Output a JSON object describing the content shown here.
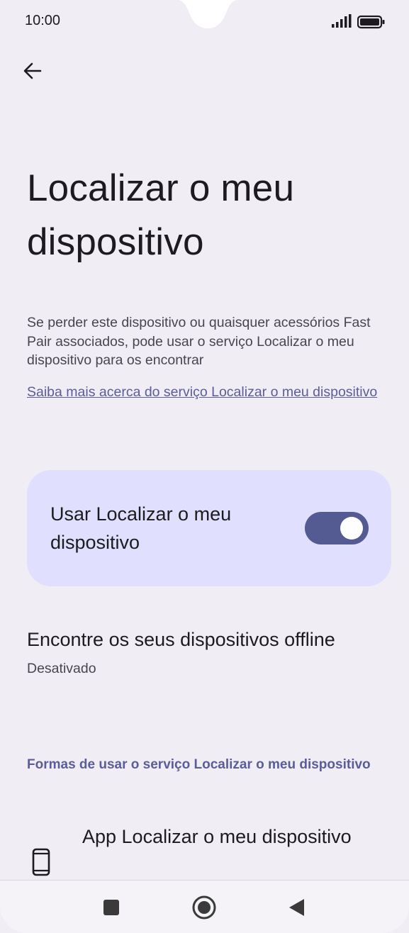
{
  "status_bar": {
    "time": "10:00",
    "icons": [
      "signal-icon",
      "battery-icon"
    ]
  },
  "toolbar": {
    "back_icon": "arrow-back-icon"
  },
  "page": {
    "title": "Localizar o meu dispositivo",
    "description": "Se perder este dispositivo ou quaisquer acessórios Fast Pair associados, pode usar o serviço Localizar o meu dispositivo para os encontrar",
    "learn_more_link": "Saiba mais acerca do serviço Localizar o meu dispositivo"
  },
  "main_toggle": {
    "label": "Usar Localizar o meu dispositivo",
    "enabled": true
  },
  "offline_setting": {
    "title": "Encontre os seus dispositivos offline",
    "status": "Desativado"
  },
  "ways_section": {
    "header": "Formas de usar o serviço Localizar o meu dispositivo",
    "items": [
      {
        "label": "App Localizar o meu dispositivo",
        "icon": "phone-icon"
      }
    ]
  },
  "nav_bar": {
    "buttons": [
      "recents-square-icon",
      "home-circle-icon",
      "back-triangle-icon"
    ]
  },
  "colors": {
    "background": "#f0edf4",
    "card": "#e0dffd",
    "accent": "#545a92",
    "link": "#5b5c9a"
  }
}
